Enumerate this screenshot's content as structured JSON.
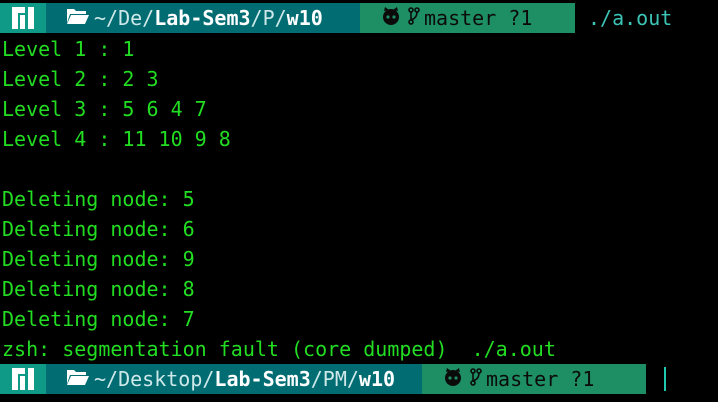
{
  "window": {
    "type": "terminal"
  },
  "colors": {
    "background": "#000000",
    "output_green": "#22dd22",
    "os_segment": "#0f9a88",
    "dir_segment": "#016d73",
    "git_segment": "#1e8f64",
    "command_text": "#3cc4b5"
  },
  "prompt_top": {
    "os_icon": "manjaro-logo-icon",
    "folder_icon": "folder-open-icon",
    "path_home": "~",
    "path_parts": [
      "/De/",
      "Lab-Sem3",
      "/P/",
      "w10"
    ],
    "git_icon": "github-octocat-icon",
    "branch_icon": "git-branch-icon",
    "branch": "master ?1",
    "command": "./a.out"
  },
  "output_lines": [
    "Level 1 : 1",
    "Level 2 : 2 3",
    "Level 3 : 5 6 4 7",
    "Level 4 : 11 10 9 8",
    "",
    "Deleting node: 5",
    "Deleting node: 6",
    "Deleting node: 9",
    "Deleting node: 8",
    "Deleting node: 7",
    "zsh: segmentation fault (core dumped)  ./a.out"
  ],
  "prompt_bottom": {
    "os_icon": "manjaro-logo-icon",
    "folder_icon": "folder-open-icon",
    "path_home": "~",
    "path_parts": [
      "/Desktop/",
      "Lab-Sem3",
      "/PM/",
      "w10"
    ],
    "git_icon": "github-octocat-icon",
    "branch_icon": "git-branch-icon",
    "branch": "master ?1"
  }
}
